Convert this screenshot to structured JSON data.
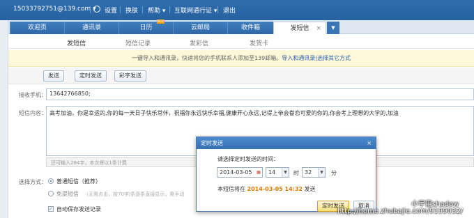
{
  "topbar": {
    "account": "15033792751@139.com",
    "settings": "设置",
    "skin": "换肤",
    "help": "帮助",
    "passport": "互联网通行证",
    "logout": "退出",
    "caret": "▾"
  },
  "tabs": [
    {
      "label": "欢迎页"
    },
    {
      "label": "通讯录"
    },
    {
      "label": "日历",
      "badge": "NEW"
    },
    {
      "label": "云邮局"
    },
    {
      "label": "收件箱"
    },
    {
      "label": "发短信",
      "close": "×"
    }
  ],
  "tab_more": "▼",
  "subnav": [
    {
      "label": "发短信"
    },
    {
      "label": "短信记录"
    },
    {
      "label": "发彩信"
    },
    {
      "label": "发贺卡"
    }
  ],
  "notice": {
    "text": "一键导入和通讯录，快速将您的手机联系人添加至139邮箱。",
    "link": "导入和通讯录|选择其它方式"
  },
  "toolbar": {
    "send": "发送",
    "timed": "定时发送",
    "color": "彩字发送"
  },
  "form": {
    "phone_label": "接收手机：",
    "phone_value": "13642766850;",
    "msg_label": "短信内容：",
    "msg_value": "高考加油，你是幸运的,你的每一天日子快乐常伴，祝福你永远快乐幸福,健康开心永远,记得上帝会眷恋可爱的你的,你会考上理想的大学的,加油",
    "counter": "还可输入284字，本次将以1条计费",
    "mode_label": "选择方式：",
    "opt1": "普通短信（推荐）",
    "opt2": "免提短信",
    "opt2_note": "（无需点击，按70字/条逐条直接显示，需手动",
    "autosave": "自动保存发送记录"
  },
  "dialog": {
    "title": "定时发送",
    "close": "×",
    "prompt": "请选择定时发送的时间：",
    "date": "2014-03-05",
    "hour": "14",
    "hour_unit": "时",
    "minute": "32",
    "minute_unit": "分",
    "info_prefix": "本短信将在",
    "info_time": "2014-03-05 14:32",
    "info_suffix": "发送",
    "ok": "定时发送",
    "cancel": "取消"
  },
  "watermark": {
    "line1": "小宇宙shadow",
    "line2": "http://home.zhubajie.com/9199032/"
  },
  "colors": {
    "brand": "#2f6eae",
    "highlight": "#e07a00",
    "notice_bg": "#fdf8d8"
  }
}
